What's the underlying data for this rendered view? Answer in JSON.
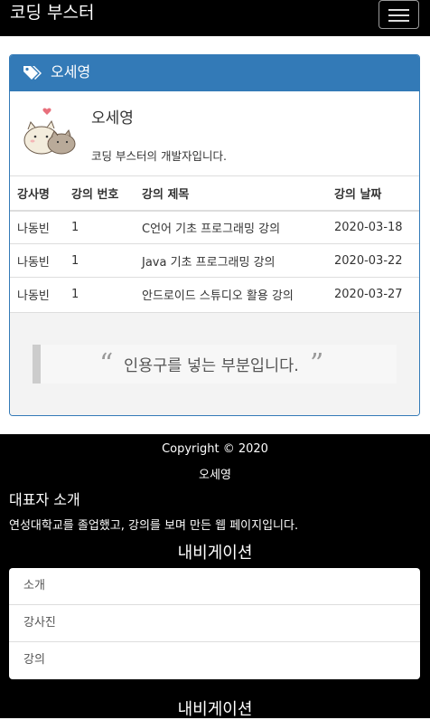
{
  "navbar": {
    "brand": "코딩 부스터",
    "menu_icon": "hamburger-menu-icon"
  },
  "panel": {
    "title": "오세영",
    "title_icon": "tags-icon",
    "accent_color": "#337ab7",
    "author": {
      "name": "오세영",
      "description": "코딩 부스터의 개발자입니다."
    },
    "table": {
      "headers": [
        "강사명",
        "강의 번호",
        "강의 제목",
        "강의 날짜"
      ],
      "rows": [
        [
          "나동빈",
          "1",
          "C언어 기초 프로그래밍 강의",
          "2020-03-18"
        ],
        [
          "나동빈",
          "1",
          "Java 기초 프로그래밍 강의",
          "2020-03-22"
        ],
        [
          "나동빈",
          "1",
          "안드로이드 스튜디오 활용 강의",
          "2020-03-27"
        ]
      ]
    },
    "quote": {
      "text": "인용구를 넣는 부분입니다."
    }
  },
  "footer": {
    "copyright": "Copyright © 2020",
    "owner": "오세영",
    "intro_title": "대표자 소개",
    "intro_text": "연성대학교를 졸업했고, 강의를 보며 만든 웹 페이지입니다.",
    "nav_title": "내비게이션",
    "nav_items": [
      "소개",
      "강사진",
      "강의"
    ],
    "nav_title_2": "내비게이션"
  }
}
